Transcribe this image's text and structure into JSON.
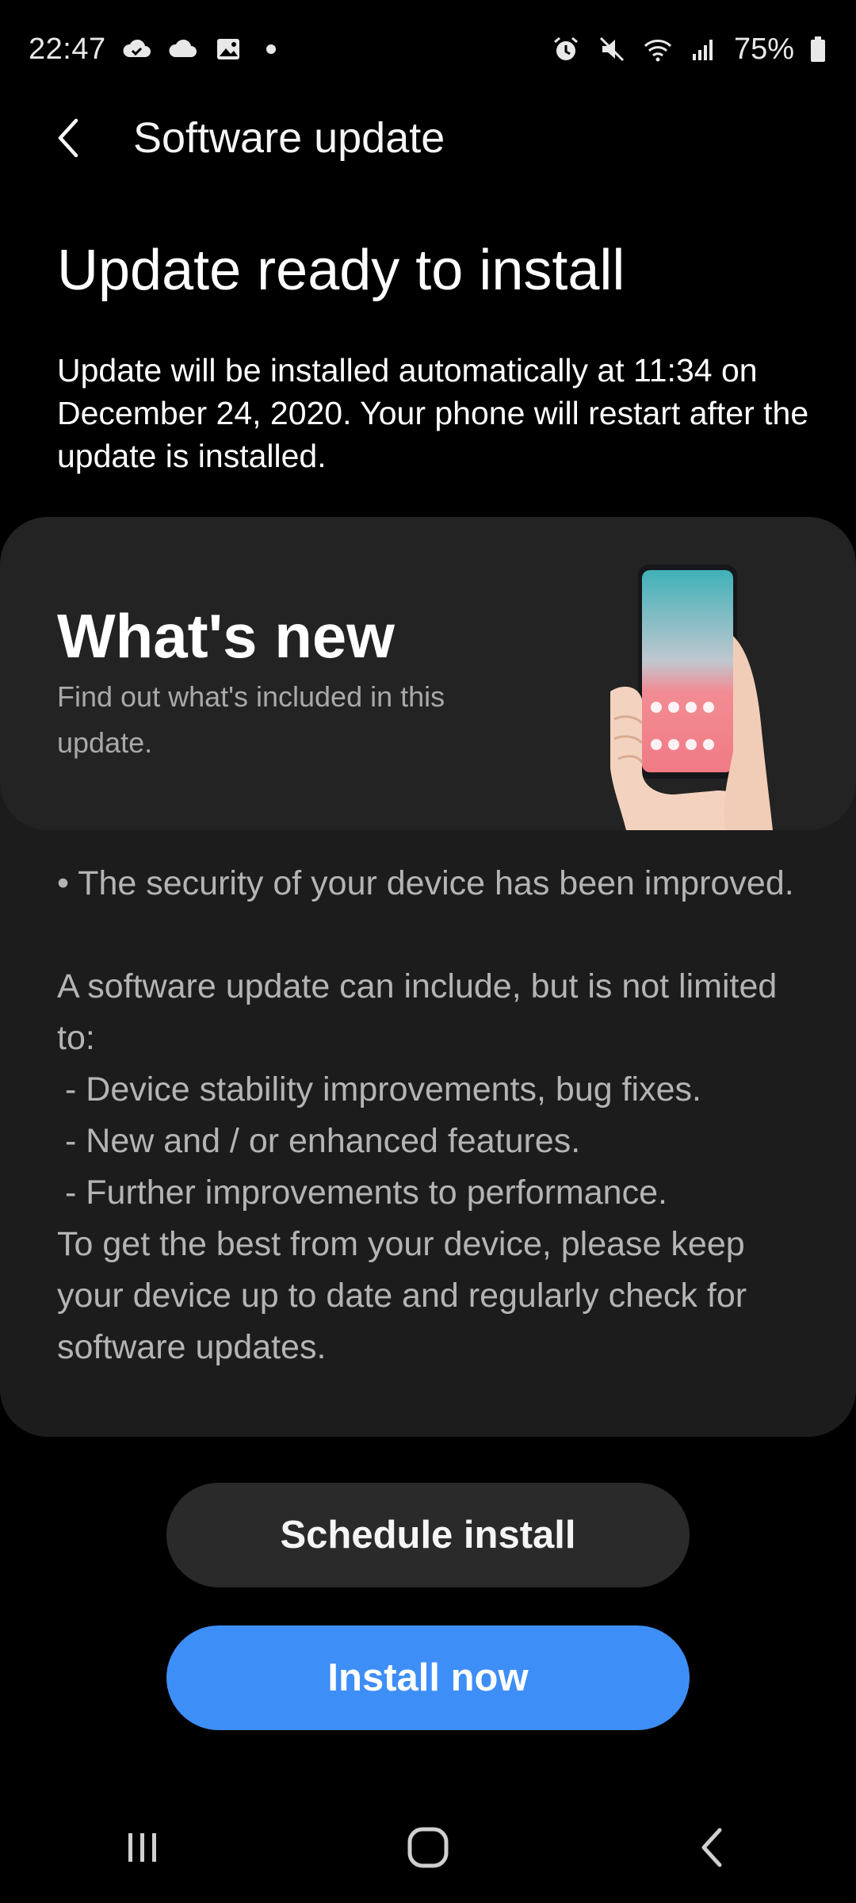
{
  "status_bar": {
    "time": "22:47",
    "battery": "75%",
    "icons_left": [
      "cloud-sync-icon",
      "cloud-icon",
      "image-icon",
      "notification-dot-icon"
    ],
    "icons_right": [
      "alarm-icon",
      "mute-icon",
      "wifi-icon",
      "signal-icon",
      "battery-icon"
    ]
  },
  "app_bar": {
    "title": "Software update"
  },
  "main": {
    "headline": "Update ready to install",
    "description": "Update will be installed automatically at 11:34 on December 24, 2020. Your phone will restart after the update is installed."
  },
  "whats_new": {
    "title": "What's new",
    "subtitle": "Find out what's included in this update.",
    "notes": {
      "bullet": "• The security of your device has been improved.",
      "intro": "A software update can include, but is not limited to:",
      "items": [
        " - Device stability improvements, bug fixes.",
        " - New and / or enhanced features.",
        " - Further improvements to performance."
      ],
      "closing": "To get the best from your device, please keep your device up to date and regularly check for software updates."
    }
  },
  "buttons": {
    "schedule": "Schedule install",
    "install": "Install now"
  },
  "colors": {
    "accent": "#3e8ef7",
    "background": "#000000",
    "card": "#1c1c1c"
  },
  "nav_bar": {
    "icons": [
      "recents-icon",
      "home-icon",
      "back-icon"
    ]
  }
}
